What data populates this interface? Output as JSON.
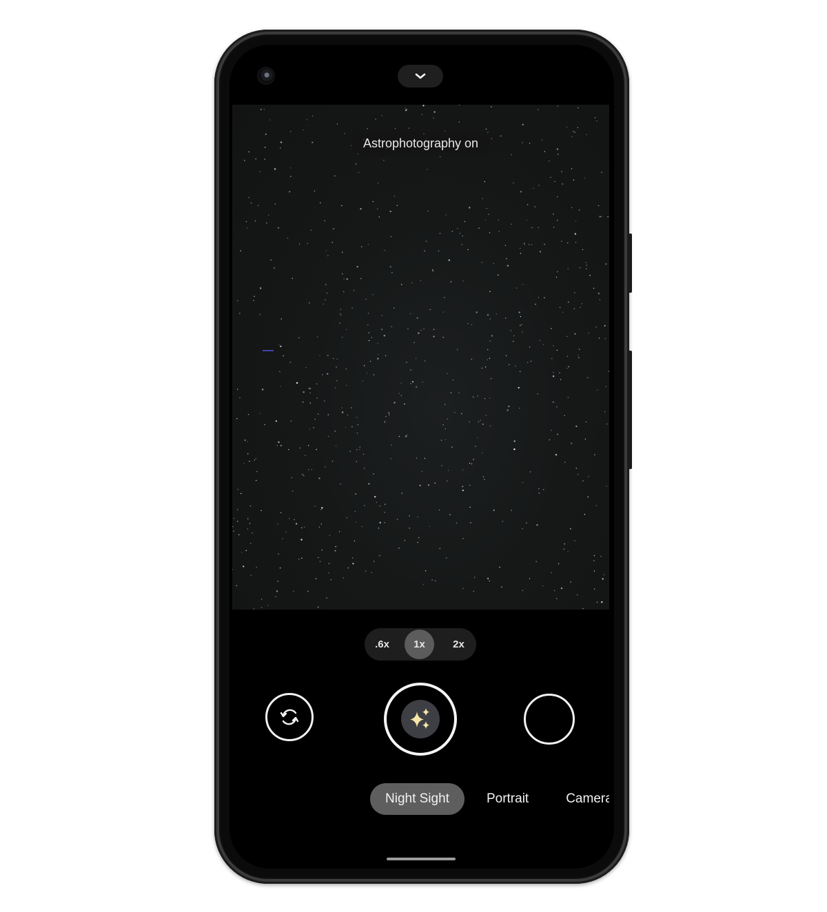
{
  "camera": {
    "toast": "Astrophotography on",
    "top_bar": {
      "expand_icon": "chevron-down-icon"
    },
    "zoom": {
      "options": [
        ".6x",
        "1x",
        "2x"
      ],
      "selected": "1x"
    },
    "controls": {
      "switch_camera_icon": "camera-switch-icon",
      "shutter_icon": "sparkles-icon",
      "gallery_thumbnail": "empty"
    },
    "modes": {
      "items": [
        "Night Sight",
        "Portrait",
        "Camera"
      ],
      "visible_text": [
        "Night Sight",
        "Portrait",
        "Came"
      ],
      "selected": "Night Sight"
    },
    "colors": {
      "shutter_icon": "#f7e7a6",
      "selected_mode_bg": "#5e5e5e",
      "zoom_selected_bg": "#5c5c5c"
    }
  }
}
